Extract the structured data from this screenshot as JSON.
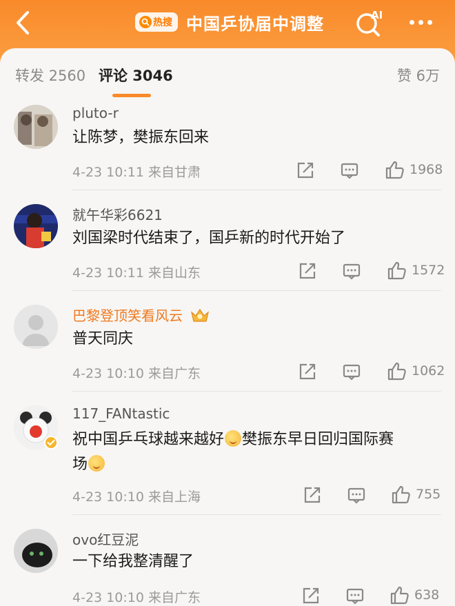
{
  "header": {
    "hot_tag": "热搜",
    "title": "中国乒协届中调整",
    "ai_label": "AI"
  },
  "tabs": {
    "repost": "转发 2560",
    "comment": "评论 3046",
    "like": "赞 6万"
  },
  "comments": [
    {
      "name": "pluto-r",
      "text": "让陈梦，樊振东回来",
      "time": "4-23 10:11",
      "location": "来自甘肃",
      "likes": "1968"
    },
    {
      "name": "就午华彩6621",
      "text": "刘国梁时代结束了，国乒新的时代开始了",
      "time": "4-23 10:11",
      "location": "来自山东",
      "likes": "1572"
    },
    {
      "name": "巴黎登顶笑看风云",
      "text": "普天同庆",
      "time": "4-23 10:10",
      "location": "来自广东",
      "likes": "1062"
    },
    {
      "name": "117_FANtastic",
      "text_a": "祝中国乒乓球越来越好",
      "text_b": "樊振东早日回归国际赛",
      "text_c": "场",
      "time": "4-23 10:10",
      "location": "来自上海",
      "likes": "755"
    },
    {
      "name": "ovo红豆泥",
      "text": "一下给我整清醒了",
      "time": "4-23 10:10",
      "location": "来自广东",
      "likes": "638"
    }
  ],
  "colors": {
    "accent": "#f98a2a",
    "vip_name": "#f0791f"
  }
}
